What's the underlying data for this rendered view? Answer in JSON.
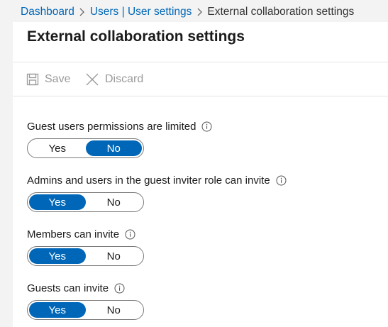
{
  "breadcrumb": {
    "items": [
      "Dashboard",
      "Users | User settings",
      "External collaboration settings"
    ]
  },
  "page": {
    "title": "External collaboration settings"
  },
  "toolbar": {
    "save_label": "Save",
    "discard_label": "Discard",
    "save_icon": "save-icon",
    "discard_icon": "close-icon"
  },
  "settings": [
    {
      "label": "Guest users permissions are limited",
      "options": [
        "Yes",
        "No"
      ],
      "selected": "No"
    },
    {
      "label": "Admins and users in the guest inviter role can invite",
      "options": [
        "Yes",
        "No"
      ],
      "selected": "Yes"
    },
    {
      "label": "Members can invite",
      "options": [
        "Yes",
        "No"
      ],
      "selected": "Yes"
    },
    {
      "label": "Guests can invite",
      "options": [
        "Yes",
        "No"
      ],
      "selected": "Yes"
    }
  ],
  "colors": {
    "accent": "#0067b8",
    "disabled_text": "#9a9a9a",
    "background": "#f3f3f3"
  }
}
